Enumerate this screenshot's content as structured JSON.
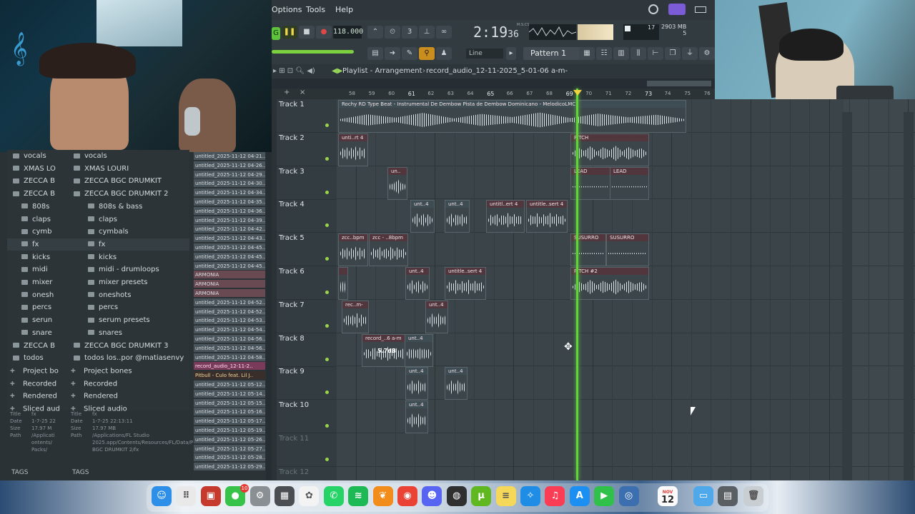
{
  "menu": {
    "options": "Options",
    "tools": "Tools",
    "help": "Help"
  },
  "transport": {
    "tempo": "118.000",
    "time": "2:19",
    "time_sub": "36",
    "time_unit": "M:S:CS",
    "mem_value": "2903 MB",
    "cpu_value": "17",
    "voices": "5",
    "snap_mode": "Line",
    "pattern": "Pattern 1"
  },
  "playlist": {
    "title": "Playlist - Arrangement",
    "file": "record_audio_12-11-2025_5-01-06 a-m-",
    "ruler": [
      "58",
      "59",
      "60",
      "61",
      "62",
      "63",
      "64",
      "65",
      "66",
      "67",
      "68",
      "69",
      "70",
      "71",
      "72",
      "73",
      "74",
      "75",
      "76"
    ],
    "tracks": [
      "Track 1",
      "Track 2",
      "Track 3",
      "Track 4",
      "Track 5",
      "Track 6",
      "Track 7",
      "Track 8",
      "Track 9",
      "Track 10",
      "Track 11",
      "Track 12"
    ],
    "clips": {
      "c1": "Rochy RD Type Beat - Instrumental De Dembow  Pista de Dembow Dominicano - MelodicoLMC",
      "c2a": "unti..rt 4",
      "c2b": "PITCH",
      "c3a": "un..",
      "c3b": "LEAD",
      "c3c": "LEAD",
      "c4a": "unt..4",
      "c4b": "unt..4",
      "c4c": "untitl..ert 4",
      "c4d": "untitle..sert 4",
      "c5a": "zcc..bpm",
      "c5b": "zcc - ..8bpm",
      "c5c": "SUSURRO",
      "c5d": "SUSURRO",
      "c6a": "",
      "c6b": "unt..4",
      "c6c": "untitle..sert 4",
      "c6d": "PITCH #2",
      "c7a": "rec..m-",
      "c7b": "unt..4",
      "c8a": "record_..6 a-m",
      "c8b": "unt..4",
      "c8gain": "5.7dB",
      "c9a": "unt..4",
      "c9b": "unt..4",
      "c10a": "unt..4"
    }
  },
  "browser_left": {
    "items": [
      "vocals",
      "XMAS LO",
      "ZECCA B",
      "ZECCA B",
      "808s",
      "claps",
      "cymb",
      "fx",
      "kicks",
      "midi",
      "mixer",
      "onesh",
      "percs",
      "serun",
      "snare",
      "ZECCA B",
      "todos",
      "Project bo",
      "Recorded",
      "Rendered",
      "Sliced aud"
    ],
    "info": {
      "title_label": "Title",
      "title": "fx",
      "date_label": "Date",
      "date": "1-7-25 22",
      "size_label": "Size",
      "size": "17.97 M",
      "path_label": "Path",
      "path": "/Applicati ontents/ Packs/"
    },
    "tags": "TAGS"
  },
  "browser_mid": {
    "items": [
      "vocals",
      "XMAS LOURI",
      "ZECCA BGC DRUMKIT",
      "ZECCA BGC DRUMKIT 2",
      "808s & bass",
      "claps",
      "cymbals",
      "fx",
      "kicks",
      "midi - drumloops",
      "mixer presets",
      "oneshots",
      "percs",
      "serum presets",
      "snares",
      "ZECCA BGC DRUMKIT 3",
      "todos los..por @matiasenvy",
      "Project bones",
      "Recorded",
      "Rendered",
      "Sliced audio"
    ],
    "info": {
      "title_label": "Title",
      "title": "fx",
      "date_label": "Date",
      "date": "1-7-25 22:13:11",
      "size_label": "Size",
      "size": "17.97 MB",
      "path_label": "Path",
      "path": "/Applications/FL Studio 2025.app/Contents/Resources/FL/Data/Patches/Packs/ZECCA BGC DRUMKIT 2/fx"
    },
    "tags": "TAGS"
  },
  "files": [
    "untitled_2025-11-12 04-21..",
    "untitled_2025-11-12 04-26..",
    "untitled_2025-11-12 04-29..",
    "untitled_2025-11-12 04-30..",
    "untitled_2025-11-12 04-34..",
    "untitled_2025-11-12 04-35..",
    "untitled_2025-11-12 04-36..",
    "untitled_2025-11-12 04-39..",
    "untitled_2025-11-12 04-42..",
    "untitled_2025-11-12 04-43..",
    "untitled_2025-11-12 04-45..",
    "untitled_2025-11-12 04-45..",
    "untitled_2025-11-12 04-45..",
    "ARMONIA",
    "ARMONIA",
    "ARMONIA",
    "untitled_2025-11-12 04-52..",
    "untitled_2025-11-12 04-52..",
    "untitled_2025-11-12 04-53..",
    "untitled_2025-11-12 04-54..",
    "untitled_2025-11-12 04-56..",
    "untitled_2025-11-12 04-56..",
    "untitled_2025-11-12 04-58..",
    "record_audio_12-11-2..",
    "Pitbull - Culo feat. Lil J..",
    "untitled_2025-11-12 05-12..",
    "untitled_2025-11-12 05-14..",
    "untitled_2025-11-12 05-15..",
    "untitled_2025-11-12 05-16..",
    "untitled_2025-11-12 05-17..",
    "untitled_2025-11-12 05-19..",
    "untitled_2025-11-12 05-26..",
    "untitled_2025-11-12 05-27..",
    "untitled_2025-11-12 05-28..",
    "untitled_2025-11-12 05-29.."
  ],
  "dock": {
    "calendar_month": "NOV",
    "calendar_day": "12",
    "badge": "10"
  },
  "colors": {
    "playhead": "#62d33a",
    "clip_title": "#52363e",
    "highlight_file": "#7a3a5a"
  }
}
